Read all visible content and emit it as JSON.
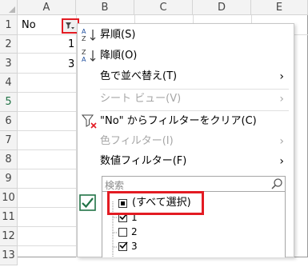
{
  "columns": [
    "A",
    "B",
    "C",
    "D",
    "E"
  ],
  "rows": [
    "1",
    "2",
    "3",
    "4",
    "5",
    "6",
    "7",
    "8",
    "9",
    "10",
    "11",
    "12",
    "13"
  ],
  "cells": {
    "a1": "No",
    "a2": "1",
    "a3": "3"
  },
  "filter_dropdown": {
    "sort_asc": "昇順(S)",
    "sort_desc": "降順(O)",
    "sort_by_color": "色で並べ替え(T)",
    "sheet_view": "シート ビュー(V)",
    "clear_filter": "\"No\" からフィルターをクリア(C)",
    "color_filter": "色フィルター(I)",
    "number_filter": "数値フィルター(F)",
    "search_placeholder": "検索",
    "items": [
      {
        "label": "(すべて選択)",
        "state": "partial"
      },
      {
        "label": "1",
        "state": "checked"
      },
      {
        "label": "2",
        "state": "unchecked"
      },
      {
        "label": "3",
        "state": "checked"
      }
    ]
  },
  "colors": {
    "highlight": "#e31b23",
    "excel_green": "#217346",
    "header_bg": "#f3f3f3",
    "disabled_text": "#a6a6a6"
  },
  "icons": [
    "filter-dropdown-icon",
    "sort-ascending-icon",
    "sort-descending-icon",
    "clear-filter-icon",
    "search-icon",
    "select-all-icon",
    "chevron-right-icon"
  ]
}
